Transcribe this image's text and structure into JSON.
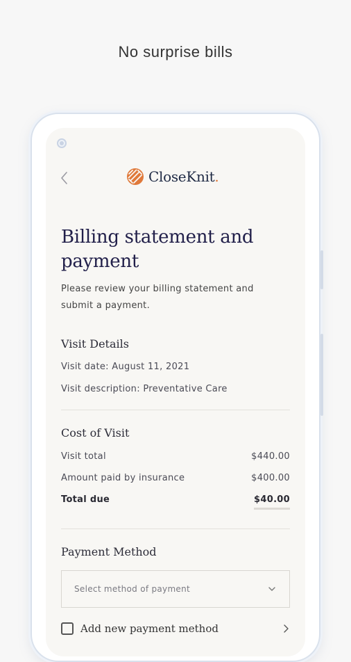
{
  "promo": {
    "headline": "No surprise bills"
  },
  "app": {
    "brand_name": "CloseKnit",
    "brand_suffix": "."
  },
  "page": {
    "title_line1": "Billing statement and",
    "title_line2": "payment",
    "subtitle_line1": "Please review your billing statement and",
    "subtitle_line2": "submit a payment."
  },
  "visit_details": {
    "heading": "Visit Details",
    "date_text": "Visit date: August 11, 2021",
    "description_text": "Visit description: Preventative Care"
  },
  "cost_of_visit": {
    "heading": "Cost of Visit",
    "rows": [
      {
        "label": "Visit total",
        "amount": "$440.00"
      },
      {
        "label": "Amount paid by insurance",
        "amount": "$400.00"
      },
      {
        "label": "Total due",
        "amount": "$40.00"
      }
    ]
  },
  "payment_method": {
    "heading": "Payment Method",
    "select_placeholder": "Select method of payment",
    "add_new_label": "Add new payment method"
  },
  "colors": {
    "brand_orange": "#e0793a",
    "title_navy": "#22204a",
    "screen_bg": "#f8f7f4"
  },
  "icons": [
    "back-chevron-icon",
    "closeknit-logo-icon",
    "chevron-down-icon",
    "chevron-right-icon",
    "camera-icon"
  ]
}
